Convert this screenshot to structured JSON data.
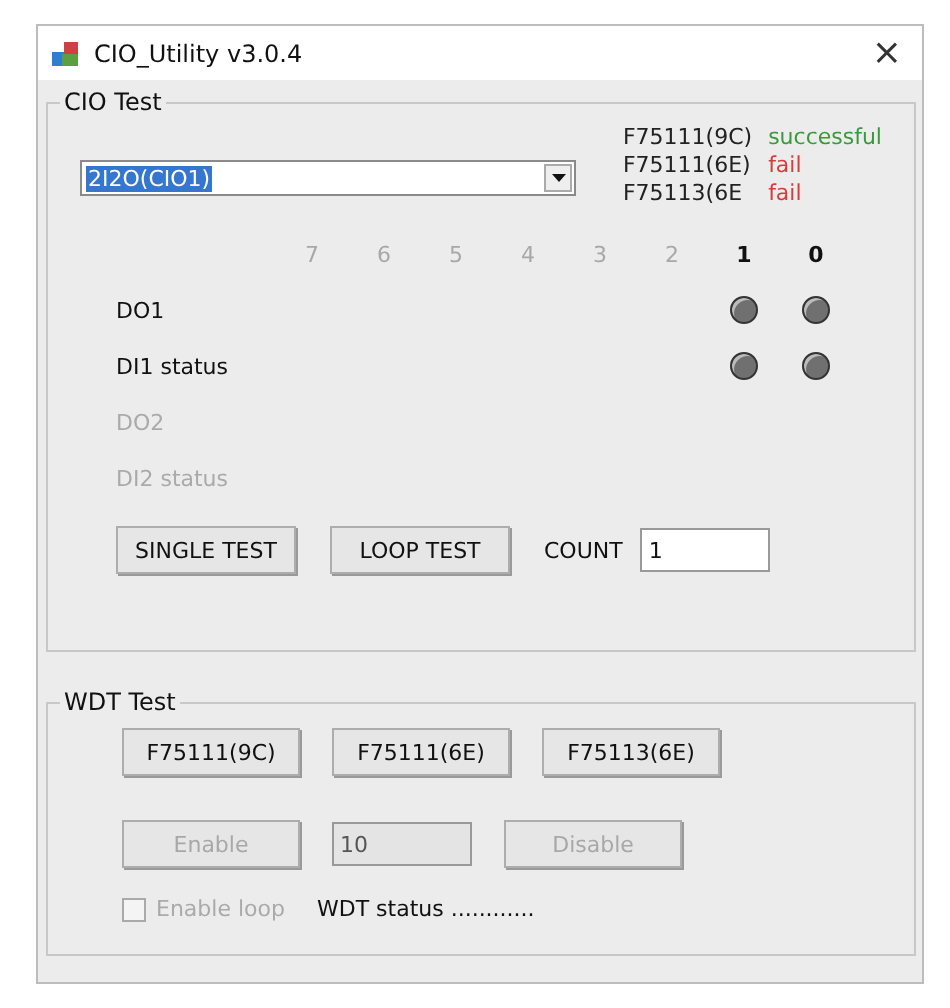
{
  "window": {
    "title": "CIO_Utility v3.0.4",
    "close": "×"
  },
  "cio_test": {
    "title": "CIO Test",
    "dropdown": {
      "value": "2I2O(CIO1)"
    },
    "results": [
      {
        "chip": "F75111(9C)",
        "result": "successful",
        "kind": "success"
      },
      {
        "chip": "F75111(6E)",
        "result": "fail",
        "kind": "fail"
      },
      {
        "chip": "F75113(6E",
        "result": "fail",
        "kind": "fail"
      }
    ],
    "bits": [
      {
        "label": "7",
        "disabled": true
      },
      {
        "label": "6",
        "disabled": true
      },
      {
        "label": "5",
        "disabled": true
      },
      {
        "label": "4",
        "disabled": true
      },
      {
        "label": "3",
        "disabled": true
      },
      {
        "label": "2",
        "disabled": true
      },
      {
        "label": "1",
        "disabled": false
      },
      {
        "label": "0",
        "disabled": false
      }
    ],
    "rows": [
      {
        "label": "DO1",
        "disabled": false,
        "leds": [
          {
            "on": false
          },
          {
            "on": false
          }
        ]
      },
      {
        "label": "DI1 status",
        "disabled": false,
        "leds": [
          {
            "on": false
          },
          {
            "on": false
          }
        ]
      },
      {
        "label": "DO2",
        "disabled": true,
        "leds": []
      },
      {
        "label": "DI2 status",
        "disabled": true,
        "leds": []
      }
    ],
    "buttons": [
      "SINGLE TEST",
      "LOOP TEST"
    ],
    "count": {
      "label": "COUNT",
      "value": "1"
    }
  },
  "wdt_test": {
    "title": "WDT Test",
    "chip_buttons": [
      "F75111(9C)",
      "F75111(6E)",
      "F75113(6E)"
    ],
    "enable": {
      "label": "Enable",
      "disabled": true
    },
    "timeout": {
      "value": "10",
      "disabled": true
    },
    "disable": {
      "label": "Disable",
      "disabled": true
    },
    "loop": {
      "label": "Enable loop",
      "checked": false,
      "disabled": true
    },
    "status": "WDT status ............"
  }
}
